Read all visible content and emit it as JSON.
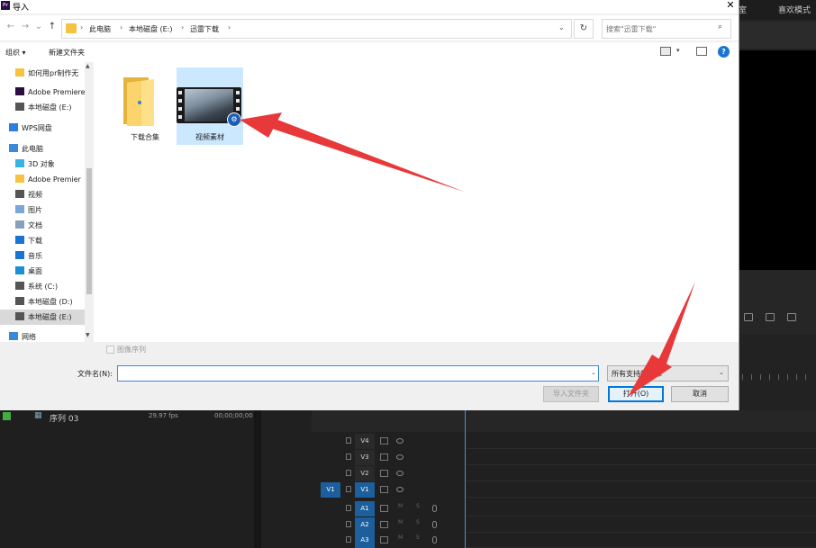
{
  "dialog": {
    "title": "导入",
    "close_glyph": "✕",
    "nav": {
      "back": "←",
      "forward": "→",
      "recent": "⌄",
      "up": "↑"
    },
    "breadcrumb": [
      "此电脑",
      "本地磁盘 (E:)",
      "迅雷下载"
    ],
    "breadcrumb_sep": "›",
    "refresh_glyph": "↻",
    "search_placeholder": "搜索\"迅雷下载\"",
    "search_glyph": "⌕",
    "toolbar": {
      "organize": "组织 ▾",
      "new_folder": "新建文件夹",
      "view_dd": "▾",
      "help": "?"
    },
    "sidebar": [
      {
        "label": "如何用pr制作无",
        "icon": "folder-icon",
        "color": "#f5c242"
      },
      {
        "label": "Adobe Premiere",
        "icon": "premiere-icon",
        "color": "#2b0e3f"
      },
      {
        "label": "本地磁盘 (E:)",
        "icon": "drive-icon",
        "color": "#555555"
      },
      {
        "label": "WPS网盘",
        "icon": "cloud-icon",
        "color": "#2f7de1"
      },
      {
        "label": "此电脑",
        "icon": "computer-icon",
        "color": "#3a8ad8"
      },
      {
        "label": "3D 对象",
        "icon": "cube-icon",
        "color": "#39b3e6"
      },
      {
        "label": "Adobe Premier",
        "icon": "folder-icon",
        "color": "#f5c242"
      },
      {
        "label": "视频",
        "icon": "video-icon",
        "color": "#555555"
      },
      {
        "label": "图片",
        "icon": "picture-icon",
        "color": "#7aa7d6"
      },
      {
        "label": "文档",
        "icon": "document-icon",
        "color": "#8aa0b8"
      },
      {
        "label": "下载",
        "icon": "download-icon",
        "color": "#1b75d0"
      },
      {
        "label": "音乐",
        "icon": "music-icon",
        "color": "#1b75d0"
      },
      {
        "label": "桌面",
        "icon": "desktop-icon",
        "color": "#1b8fd6"
      },
      {
        "label": "系统 (C:)",
        "icon": "drive-icon",
        "color": "#555555"
      },
      {
        "label": "本地磁盘 (D:)",
        "icon": "drive-icon",
        "color": "#555555"
      },
      {
        "label": "本地磁盘 (E:)",
        "icon": "drive-icon",
        "color": "#555555"
      },
      {
        "label": "网络",
        "icon": "network-icon",
        "color": "#3a8ad8"
      }
    ],
    "files": [
      {
        "label": "下载合集",
        "icon": "folder-icon"
      },
      {
        "label": "视频素材",
        "icon": "video-file-icon",
        "badge": "⚙"
      }
    ],
    "image_sequence_label": "图像序列",
    "filename_label": "文件名(N):",
    "filename_value": "",
    "filetype_value": "所有支持的媒体",
    "import_folder_label": "导入文件夹",
    "open_label": "打开(O)",
    "cancel_label": "取消"
  },
  "premiere": {
    "workspaces": [
      "室",
      "喜欢模式"
    ],
    "sequence": {
      "name": "序列 03",
      "fps": "29.97 fps",
      "timecode": "00;00;00;00"
    },
    "tracks": [
      "V4",
      "V3",
      "V2",
      "V1",
      "A1",
      "A2",
      "A3"
    ],
    "source_patch": "V1",
    "track_m": "M",
    "track_s": "S"
  },
  "colors": {
    "accent": "#0078d7",
    "arrow": "#e8393a",
    "timeline_blue": "#1d5f9c"
  }
}
